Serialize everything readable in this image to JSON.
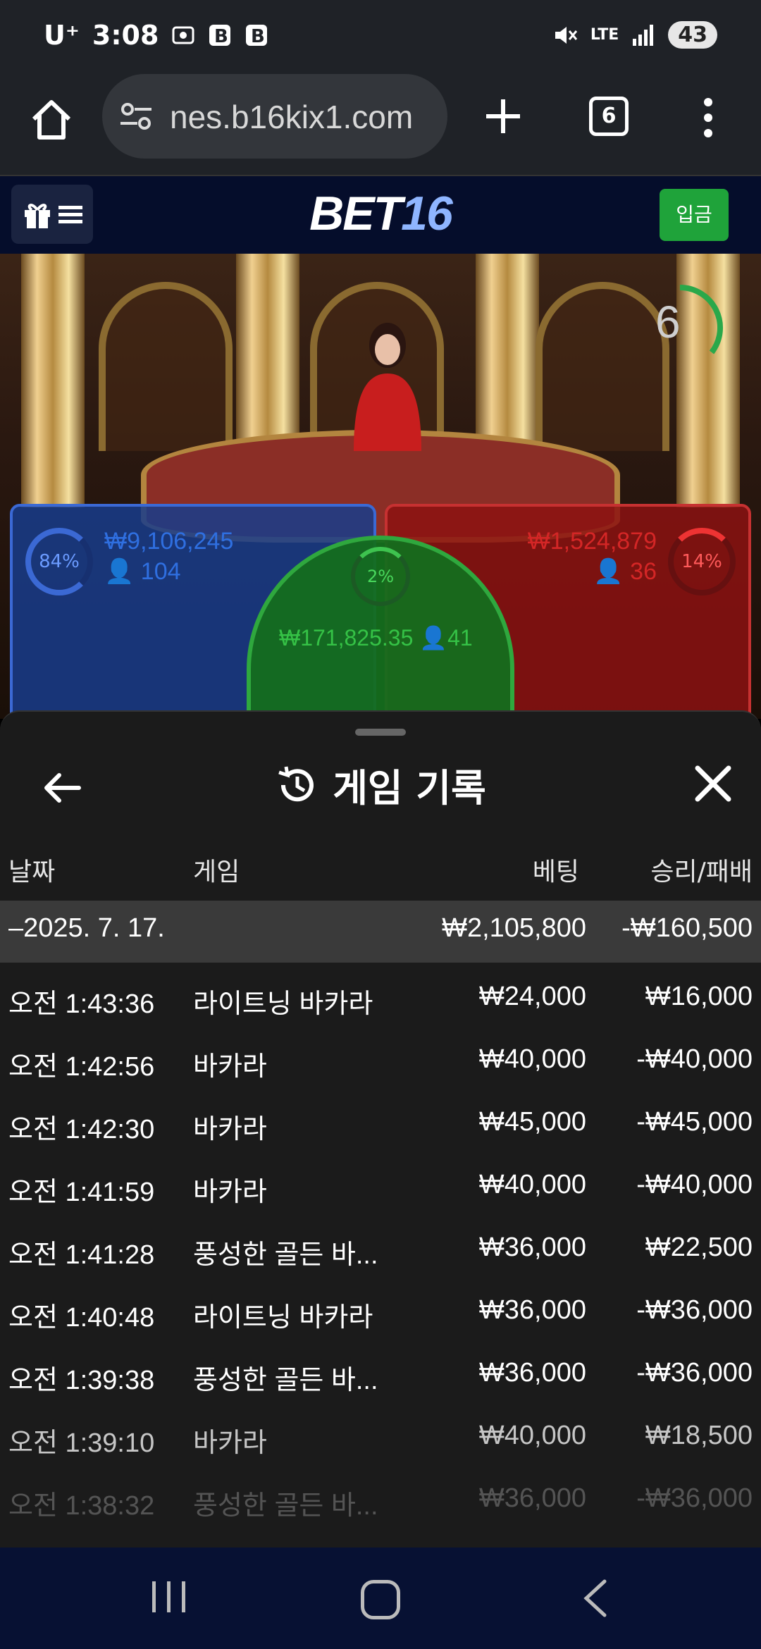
{
  "status_bar": {
    "carrier": "U⁺",
    "time": "3:08",
    "network": "LTE",
    "battery": "43"
  },
  "browser": {
    "url": "nes.b16kix1.com",
    "tab_count": "6"
  },
  "site_header": {
    "logo_main": "BET",
    "logo_num": "16",
    "deposit_label": "입금"
  },
  "game": {
    "timer": "6",
    "player": {
      "percent": "84%",
      "amount": "₩9,106,245",
      "players": "104"
    },
    "banker": {
      "percent": "14%",
      "amount": "₩1,524,879",
      "players": "36"
    },
    "tie": {
      "percent": "2%",
      "amount": "₩171,825.35",
      "players": "41"
    }
  },
  "history": {
    "title": "게임 기록",
    "columns": {
      "date": "날짜",
      "game": "게임",
      "bet": "베팅",
      "result": "승리/패배"
    },
    "summary": {
      "date": "–2025. 7. 17.",
      "bet": "₩2,105,800",
      "result": "-₩160,500"
    },
    "rows": [
      {
        "time": "오전 1:43:36",
        "game": "라이트닝 바카라",
        "bet": "₩24,000",
        "result": "₩16,000"
      },
      {
        "time": "오전 1:42:56",
        "game": "바카라",
        "bet": "₩40,000",
        "result": "-₩40,000"
      },
      {
        "time": "오전 1:42:30",
        "game": "바카라",
        "bet": "₩45,000",
        "result": "-₩45,000"
      },
      {
        "time": "오전 1:41:59",
        "game": "바카라",
        "bet": "₩40,000",
        "result": "-₩40,000"
      },
      {
        "time": "오전 1:41:28",
        "game": "풍성한 골든 바...",
        "bet": "₩36,000",
        "result": "₩22,500"
      },
      {
        "time": "오전 1:40:48",
        "game": "라이트닝 바카라",
        "bet": "₩36,000",
        "result": "-₩36,000"
      },
      {
        "time": "오전 1:39:38",
        "game": "풍성한 골든 바...",
        "bet": "₩36,000",
        "result": "-₩36,000"
      },
      {
        "time": "오전 1:39:10",
        "game": "바카라",
        "bet": "₩40,000",
        "result": "₩18,500"
      },
      {
        "time": "오전 1:38:32",
        "game": "풍성한 골든 바...",
        "bet": "₩36,000",
        "result": "-₩36,000"
      }
    ]
  },
  "colors": {
    "player_blue": "#2f6fe0",
    "banker_red": "#d42626",
    "tie_green": "#35c246",
    "deposit_green": "#1fa33a",
    "sheet_bg": "#1b1b1b"
  }
}
